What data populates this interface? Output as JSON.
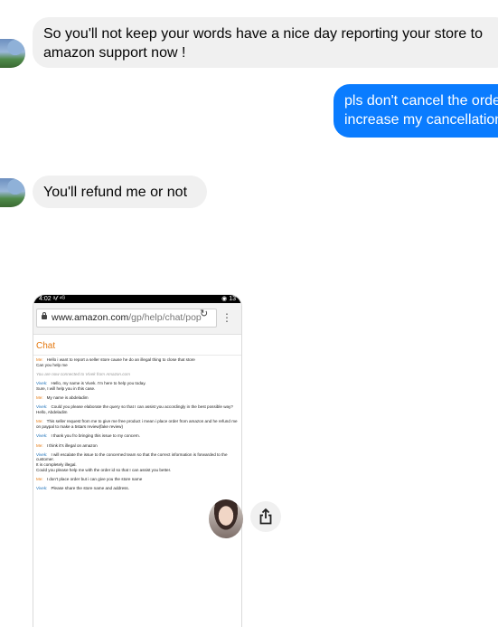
{
  "messages": {
    "m1": "So you'll not keep your words have a nice day reporting your store to amazon support now !",
    "m2": "pls don't cancel the order it will increase my cancellation rate.",
    "m3": "You'll refund me or not"
  },
  "phone": {
    "status_time": "4:02",
    "status_signal": "ᵃ𝓁 ⁴ᴳ",
    "status_right": "◉ 13",
    "url_domain": "www.amazon.com",
    "url_path": "/gp/help/chat/pop",
    "chat_title": "Chat",
    "lines": [
      {
        "who": "Me:",
        "text": "Hello i want to report a seller store cause he do an illegal thing to close that store"
      },
      {
        "who": "",
        "text": "Can you help me"
      },
      {
        "who": "",
        "text": "You are now connected to Vivek from Amazon.com"
      },
      {
        "who": "Vivek:",
        "text": "Hello, my name is Vivek. I'm here to help you today."
      },
      {
        "who": "",
        "text": "Sure, I will help you in this case."
      },
      {
        "who": "Me:",
        "text": "My name is abdeladim"
      },
      {
        "who": "Vivek:",
        "text": "Could you please elaborate the query so that I can assist you accordingly in the best possible way?"
      },
      {
        "who": "",
        "text": "Hello, Abdeladim"
      },
      {
        "who": "Me:",
        "text": "This seller request from me to give me free product i mean i place order from amazon and he refund me on paypal to make a 5stars review(fake review)"
      },
      {
        "who": "Vivek:",
        "text": "I thank you fro bringing this issue to my concern."
      },
      {
        "who": "Me:",
        "text": "I think it's illegal on amazon"
      },
      {
        "who": "Vivek:",
        "text": "I will escalate the issue to the concerned team so that the correct information is forwarded to the customer."
      },
      {
        "who": "",
        "text": "It is completely illegal."
      },
      {
        "who": "",
        "text": "Could you please help me with the order id so that I can assist you better."
      },
      {
        "who": "Me:",
        "text": "I don't place order but i can give you the store name"
      },
      {
        "who": "Vivek:",
        "text": "Please share the store name and address."
      }
    ]
  },
  "icons": {
    "share": "share-icon",
    "reload": "↻",
    "kebab": "⋮"
  }
}
